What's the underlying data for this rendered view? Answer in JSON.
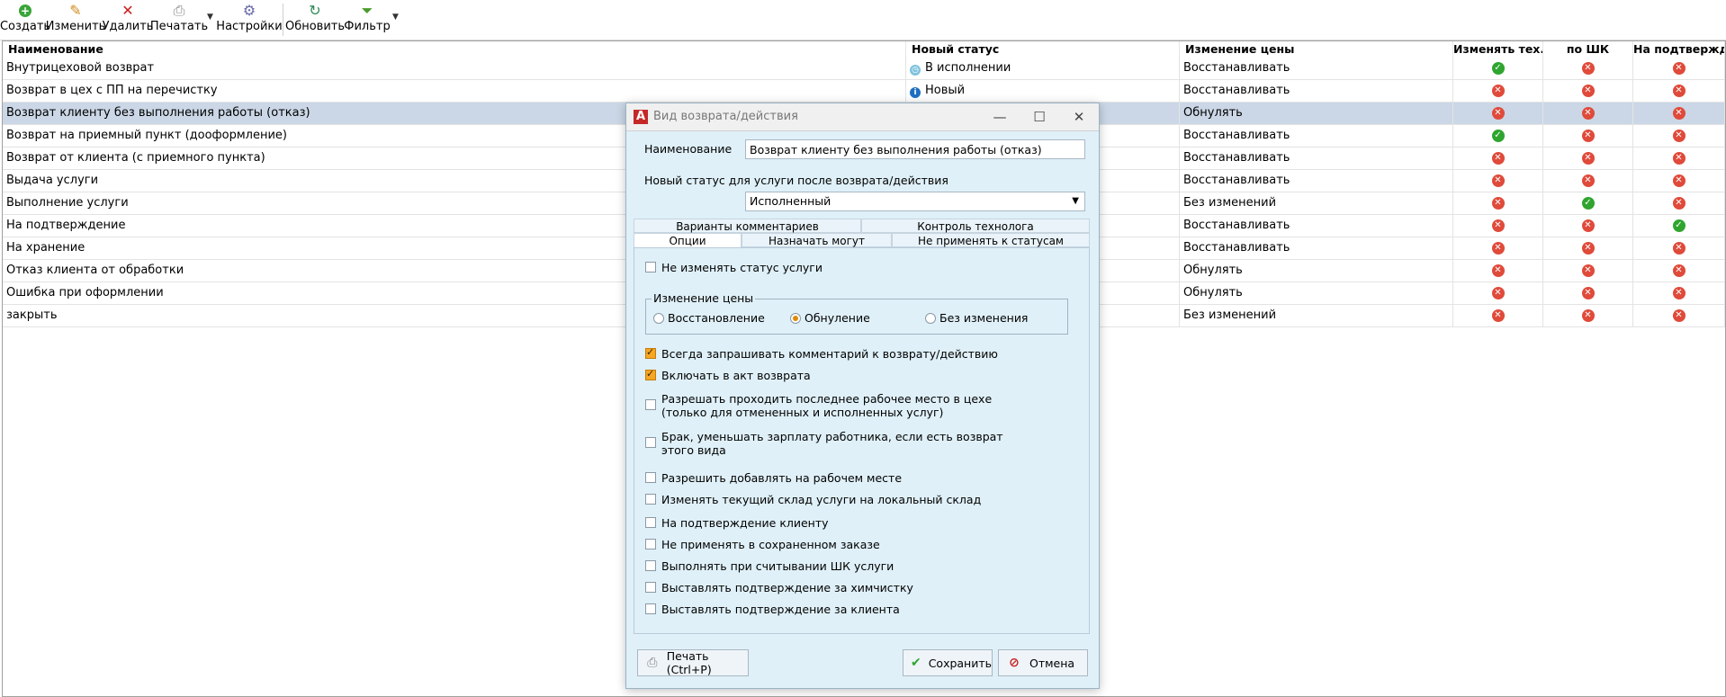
{
  "toolbar": {
    "create": "Создать",
    "edit": "Изменить",
    "delete": "Удалить",
    "print": "Печатать",
    "settings": "Настройки",
    "refresh": "Обновить",
    "filter": "Фильтр"
  },
  "grid": {
    "columns": [
      "Наименование",
      "Новый статус",
      "Изменение цены",
      "Изменять тех...",
      "по ШК",
      "На подтвержд..."
    ],
    "rows": [
      {
        "name": "Внутрицеховой возврат",
        "status": "В исполнении",
        "status_icon": "clock-icon",
        "price": "Восстанавливать",
        "c1": true,
        "c2": false,
        "c3": false
      },
      {
        "name": "Возврат в цех с ПП на перечистку",
        "status": "Новый",
        "status_icon": "info-icon",
        "price": "Восстанавливать",
        "c1": false,
        "c2": false,
        "c3": false
      },
      {
        "name": "Возврат клиенту без выполнения работы (отказ)",
        "status": "",
        "status_icon": "",
        "price": "Обнулять",
        "c1": false,
        "c2": false,
        "c3": false,
        "selected": true
      },
      {
        "name": "Возврат на приемный пункт (дооформление)",
        "status": "",
        "status_icon": "",
        "price": "Восстанавливать",
        "c1": true,
        "c2": false,
        "c3": false
      },
      {
        "name": "Возврат от клиента (с приемного пункта)",
        "status": "",
        "status_icon": "",
        "price": "Восстанавливать",
        "c1": false,
        "c2": false,
        "c3": false
      },
      {
        "name": "Выдача услуги",
        "status": "",
        "status_icon": "",
        "price": "Восстанавливать",
        "c1": false,
        "c2": false,
        "c3": false
      },
      {
        "name": "Выполнение услуги",
        "status": "",
        "status_icon": "",
        "price": "Без изменений",
        "c1": false,
        "c2": true,
        "c3": false
      },
      {
        "name": "На подтверждение",
        "status": "",
        "status_icon": "",
        "price": "Восстанавливать",
        "c1": false,
        "c2": false,
        "c3": true
      },
      {
        "name": "На хранение",
        "status": "",
        "status_icon": "",
        "price": "Восстанавливать",
        "c1": false,
        "c2": false,
        "c3": false
      },
      {
        "name": "Отказ клиента от обработки",
        "status": "",
        "status_icon": "",
        "price": "Обнулять",
        "c1": false,
        "c2": false,
        "c3": false
      },
      {
        "name": "Ошибка при оформлении",
        "status": "",
        "status_icon": "",
        "price": "Обнулять",
        "c1": false,
        "c2": false,
        "c3": false
      },
      {
        "name": "закрыть",
        "status": "",
        "status_icon": "",
        "price": "Без изменений",
        "c1": false,
        "c2": false,
        "c3": false
      }
    ]
  },
  "dialog": {
    "title": "Вид возврата/действия",
    "name_label": "Наименование",
    "name_value": "Возврат клиенту без выполнения работы (отказ)",
    "status_label": "Новый статус для услуги после возврата/действия",
    "status_value": "Исполненный",
    "tabs_top": [
      "Варианты комментариев",
      "Контроль технолога"
    ],
    "tabs_bottom": [
      "Опции",
      "Назначать могут",
      "Не применять к статусам"
    ],
    "options": {
      "dont_change_status": "Не изменять статус услуги",
      "price_group": "Изменение цены",
      "radio_restore": "Восстановление",
      "radio_zero": "Обнуление",
      "radio_none": "Без изменения",
      "always_ask": "Всегда запрашивать комментарий к возврату/действию",
      "include_act": "Включать в акт возврата",
      "allow_last_1": "Разрешать проходить последнее рабочее место в цехе",
      "allow_last_2": "(только для отмененных и исполненных услуг)",
      "defect_1": "Брак, уменьшать зарплату работника, если есть возврат",
      "defect_2": "этого вида",
      "allow_add": "Разрешить добавлять на рабочем месте",
      "change_wh": "Изменять текущий склад услуги на локальный склад",
      "confirm_client": "На подтверждение клиенту",
      "not_saved": "Не применять в сохраненном заказе",
      "on_scan": "Выполнять при считывании ШК услуги",
      "confirm_dry": "Выставлять подтверждение за химчистку",
      "confirm_for_client": "Выставлять подтверждение за клиента"
    },
    "print_btn": "Печать (Ctrl+P)",
    "save_btn": "Сохранить",
    "cancel_btn": "Отмена"
  }
}
